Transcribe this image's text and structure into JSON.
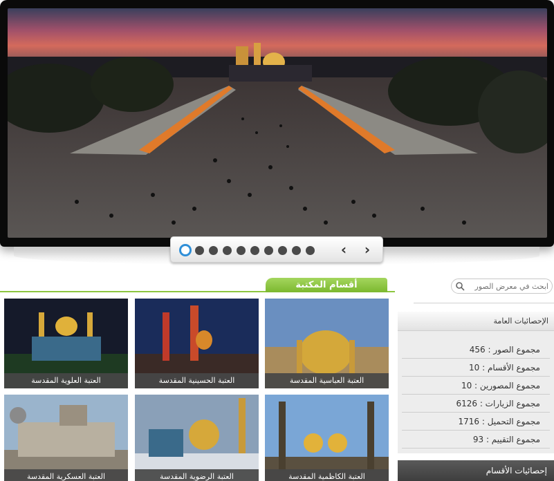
{
  "slider": {
    "slide_count": 10,
    "active_index": 0,
    "prev_label": "‹",
    "next_label": "›"
  },
  "library": {
    "title": "أقسام المكتبة",
    "cards": [
      {
        "caption": "العتبة العباسية المقدسة"
      },
      {
        "caption": "العتبة الحسينية المقدسة"
      },
      {
        "caption": "العتبة العلوية المقدسة"
      },
      {
        "caption": "العتبة الكاظمية المقدسة"
      },
      {
        "caption": "العتبة الرضوية المقدسة"
      },
      {
        "caption": "العتبة العسكرية المقدسة"
      }
    ]
  },
  "search": {
    "placeholder": "ابحث في معرض الصور"
  },
  "stats": {
    "title": "الإحصائيات العامة",
    "items": [
      {
        "label": "مجموع الصور :",
        "value": "456"
      },
      {
        "label": "مجموع الأقسام :",
        "value": "10"
      },
      {
        "label": "مجموع المصورين :",
        "value": "10"
      },
      {
        "label": "مجموع الزيارات :",
        "value": "6126"
      },
      {
        "label": "مجموع التحميل :",
        "value": "1716"
      },
      {
        "label": "مجموع التقييم :",
        "value": "93"
      }
    ]
  },
  "categories": {
    "title": "إحصائيات الأقسام"
  },
  "colors": {
    "accent_green": "#8dc63f",
    "active_dot": "#2f8fd8",
    "caption_bar": "#464646"
  }
}
